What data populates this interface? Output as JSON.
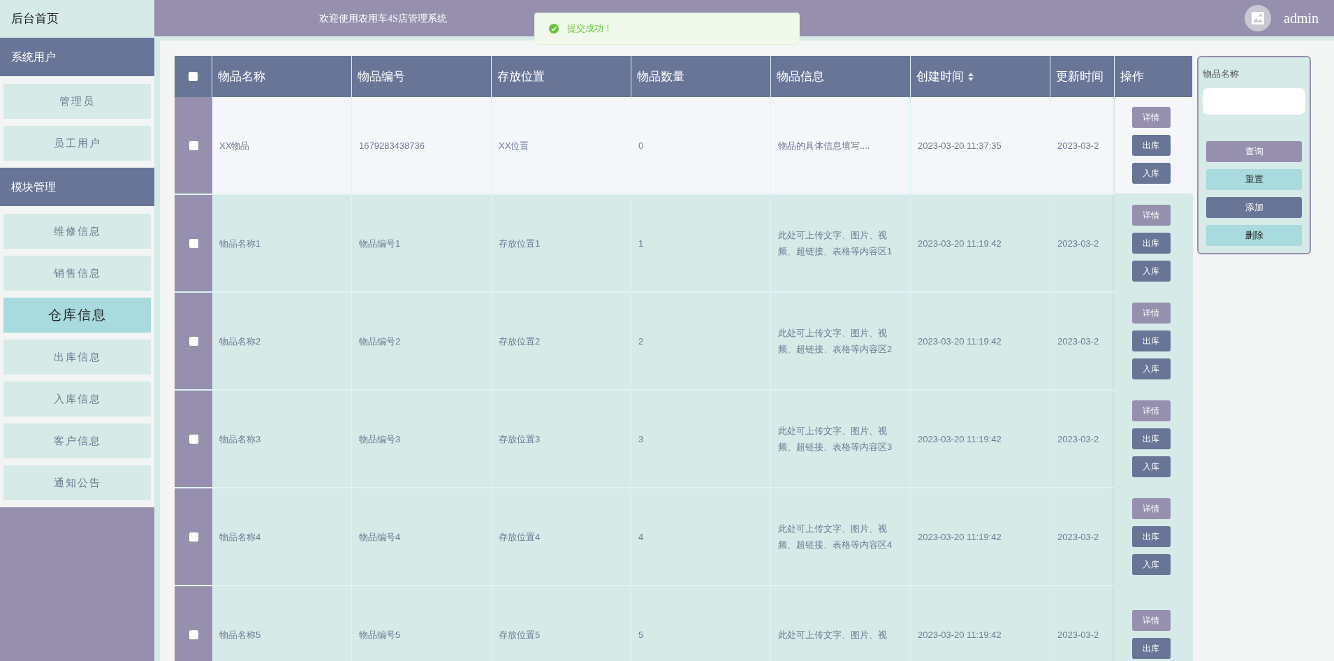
{
  "sidebar": {
    "home": "后台首页",
    "groups": [
      {
        "title": "系统用户",
        "items": [
          {
            "label": "管理员",
            "selected": false
          },
          {
            "label": "员工用户",
            "selected": false
          }
        ]
      },
      {
        "title": "模块管理",
        "items": [
          {
            "label": "维修信息",
            "selected": false
          },
          {
            "label": "销售信息",
            "selected": false
          },
          {
            "label": "仓库信息",
            "selected": true
          },
          {
            "label": "出库信息",
            "selected": false
          },
          {
            "label": "入库信息",
            "selected": false
          },
          {
            "label": "客户信息",
            "selected": false
          },
          {
            "label": "通知公告",
            "selected": false
          }
        ]
      }
    ]
  },
  "header": {
    "title": "欢迎使用农用车4S店管理系统",
    "user": "admin"
  },
  "toast": {
    "kind": "success",
    "message": "提交成功！"
  },
  "table": {
    "select_all": {
      "checked": false
    },
    "columns": [
      {
        "label": "物品名称",
        "sortable": false
      },
      {
        "label": "物品编号",
        "sortable": false
      },
      {
        "label": "存放位置",
        "sortable": false
      },
      {
        "label": "物品数量",
        "sortable": false
      },
      {
        "label": "物品信息",
        "sortable": false
      },
      {
        "label": "创建时间",
        "sortable": true
      },
      {
        "label": "更新时间",
        "sortable": false
      },
      {
        "label": "操作",
        "sortable": false
      }
    ],
    "rows": [
      {
        "checked": false,
        "highlighted": true,
        "cells": [
          "XX物品",
          "1679283438736",
          "XX位置",
          "0",
          "物品的具体信息填写....",
          "2023-03-20 11:37:35",
          "2023-03-2"
        ],
        "actions": [
          {
            "label": "详情",
            "kind": "detail"
          },
          {
            "label": "出库",
            "kind": "out"
          },
          {
            "label": "入库",
            "kind": "in"
          }
        ]
      },
      {
        "checked": false,
        "highlighted": false,
        "cells": [
          "物品名称1",
          "物品编号1",
          "存放位置1",
          "1",
          "此处可上传文字、图片、视频、超链接、表格等内容区1",
          "2023-03-20 11:19:42",
          "2023-03-2"
        ],
        "actions": [
          {
            "label": "详情",
            "kind": "detail"
          },
          {
            "label": "出库",
            "kind": "out"
          },
          {
            "label": "入库",
            "kind": "in"
          }
        ]
      },
      {
        "checked": false,
        "highlighted": false,
        "cells": [
          "物品名称2",
          "物品编号2",
          "存放位置2",
          "2",
          "此处可上传文字、图片、视频、超链接、表格等内容区2",
          "2023-03-20 11:19:42",
          "2023-03-2"
        ],
        "actions": [
          {
            "label": "详情",
            "kind": "detail"
          },
          {
            "label": "出库",
            "kind": "out"
          },
          {
            "label": "入库",
            "kind": "in"
          }
        ]
      },
      {
        "checked": false,
        "highlighted": false,
        "cells": [
          "物品名称3",
          "物品编号3",
          "存放位置3",
          "3",
          "此处可上传文字、图片、视频、超链接、表格等内容区3",
          "2023-03-20 11:19:42",
          "2023-03-2"
        ],
        "actions": [
          {
            "label": "详情",
            "kind": "detail"
          },
          {
            "label": "出库",
            "kind": "out"
          },
          {
            "label": "入库",
            "kind": "in"
          }
        ]
      },
      {
        "checked": false,
        "highlighted": false,
        "cells": [
          "物品名称4",
          "物品编号4",
          "存放位置4",
          "4",
          "此处可上传文字、图片、视频、超链接、表格等内容区4",
          "2023-03-20 11:19:42",
          "2023-03-2"
        ],
        "actions": [
          {
            "label": "详情",
            "kind": "detail"
          },
          {
            "label": "出库",
            "kind": "out"
          },
          {
            "label": "入库",
            "kind": "in"
          }
        ]
      },
      {
        "checked": false,
        "highlighted": false,
        "cells": [
          "物品名称5",
          "物品编号5",
          "存放位置5",
          "5",
          "此处可上传文字、图片、视",
          "2023-03-20 11:19:42",
          "2023-03-2"
        ],
        "actions": [
          {
            "label": "详情",
            "kind": "detail"
          },
          {
            "label": "出库",
            "kind": "out"
          }
        ]
      }
    ]
  },
  "search_panel": {
    "label": "物品名称",
    "buttons": [
      {
        "label": "查询",
        "kind": "query"
      },
      {
        "label": "重置",
        "kind": "reset"
      },
      {
        "label": "添加",
        "kind": "add"
      },
      {
        "label": "删除",
        "kind": "delete"
      }
    ]
  }
}
